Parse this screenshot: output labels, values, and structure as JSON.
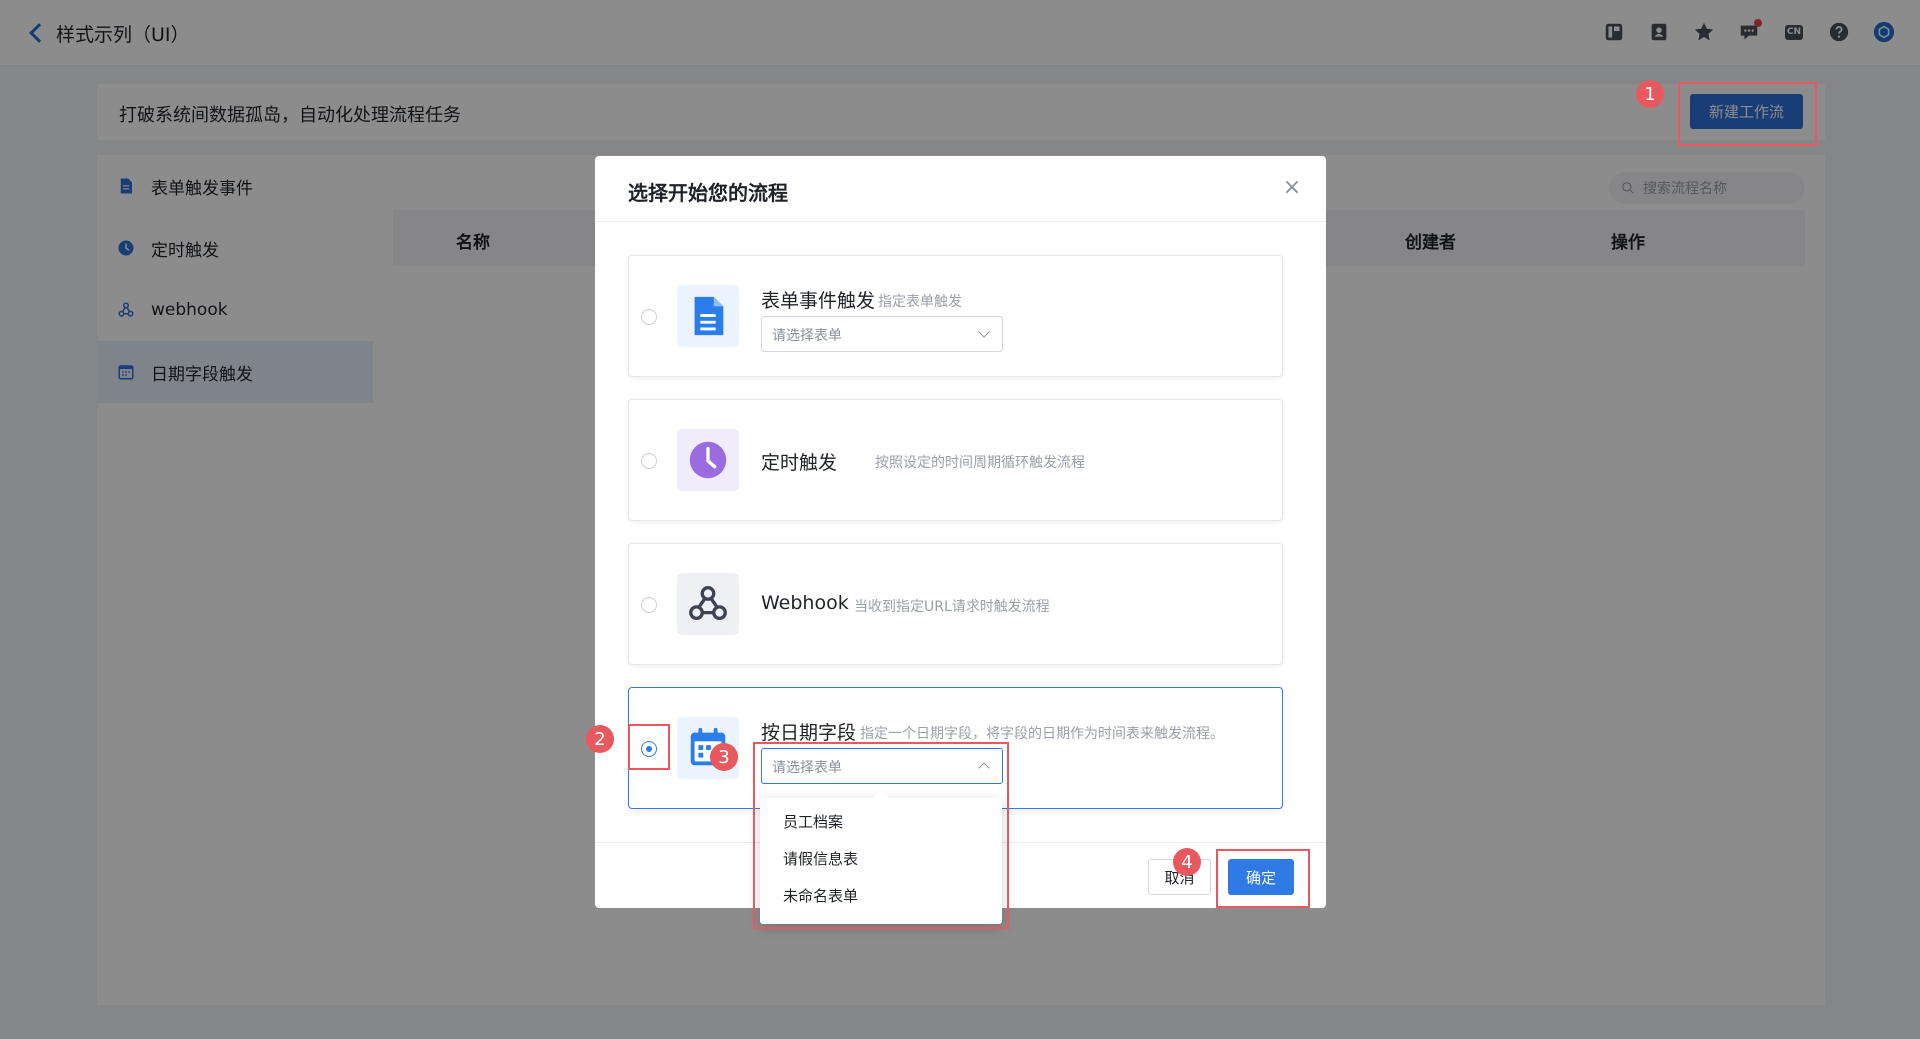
{
  "topbar": {
    "title": "样式示列（UI）",
    "icons": [
      "layout-icon",
      "contacts-icon",
      "star-icon",
      "message-icon",
      "language-icon",
      "help-icon",
      "avatar-icon"
    ],
    "language_label": "CN"
  },
  "banner": {
    "text": "打破系统间数据孤岛，自动化处理流程任务",
    "new_button": "新建工作流"
  },
  "sidebar": {
    "items": [
      {
        "label": "表单触发事件",
        "icon": "document-icon"
      },
      {
        "label": "定时触发",
        "icon": "clock-icon"
      },
      {
        "label": "webhook",
        "icon": "webhook-icon"
      },
      {
        "label": "日期字段触发",
        "icon": "calendar-icon",
        "active": true
      }
    ]
  },
  "search": {
    "placeholder": "搜索流程名称"
  },
  "table": {
    "headers": [
      "名称",
      "创建者",
      "操作"
    ]
  },
  "modal": {
    "title": "选择开始您的流程",
    "close": "×",
    "options": [
      {
        "name": "表单事件触发",
        "desc": "指定表单触发",
        "icon": "document-icon",
        "select_placeholder": "请选择表单",
        "selected": false
      },
      {
        "name": "定时触发",
        "desc": "按照设定的时间周期循环触发流程",
        "icon": "clock-icon",
        "selected": false
      },
      {
        "name": "Webhook",
        "desc": "当收到指定URL请求时触发流程",
        "icon": "webhook-icon",
        "selected": false
      },
      {
        "name": "按日期字段",
        "desc": "指定一个日期字段，将字段的日期作为时间表来触发流程。",
        "icon": "calendar-icon",
        "select_placeholder": "请选择表单",
        "selected": true
      }
    ],
    "dropdown_items": [
      "员工档案",
      "请假信息表",
      "未命名表单"
    ],
    "cancel": "取消",
    "confirm": "确定"
  },
  "annotations": [
    "1",
    "2",
    "3",
    "4"
  ],
  "colors": {
    "primary": "#2f7ae5",
    "annotation": "#e8595f",
    "doc_icon": "#2b7de9",
    "clock_icon": "#9b6be0"
  }
}
